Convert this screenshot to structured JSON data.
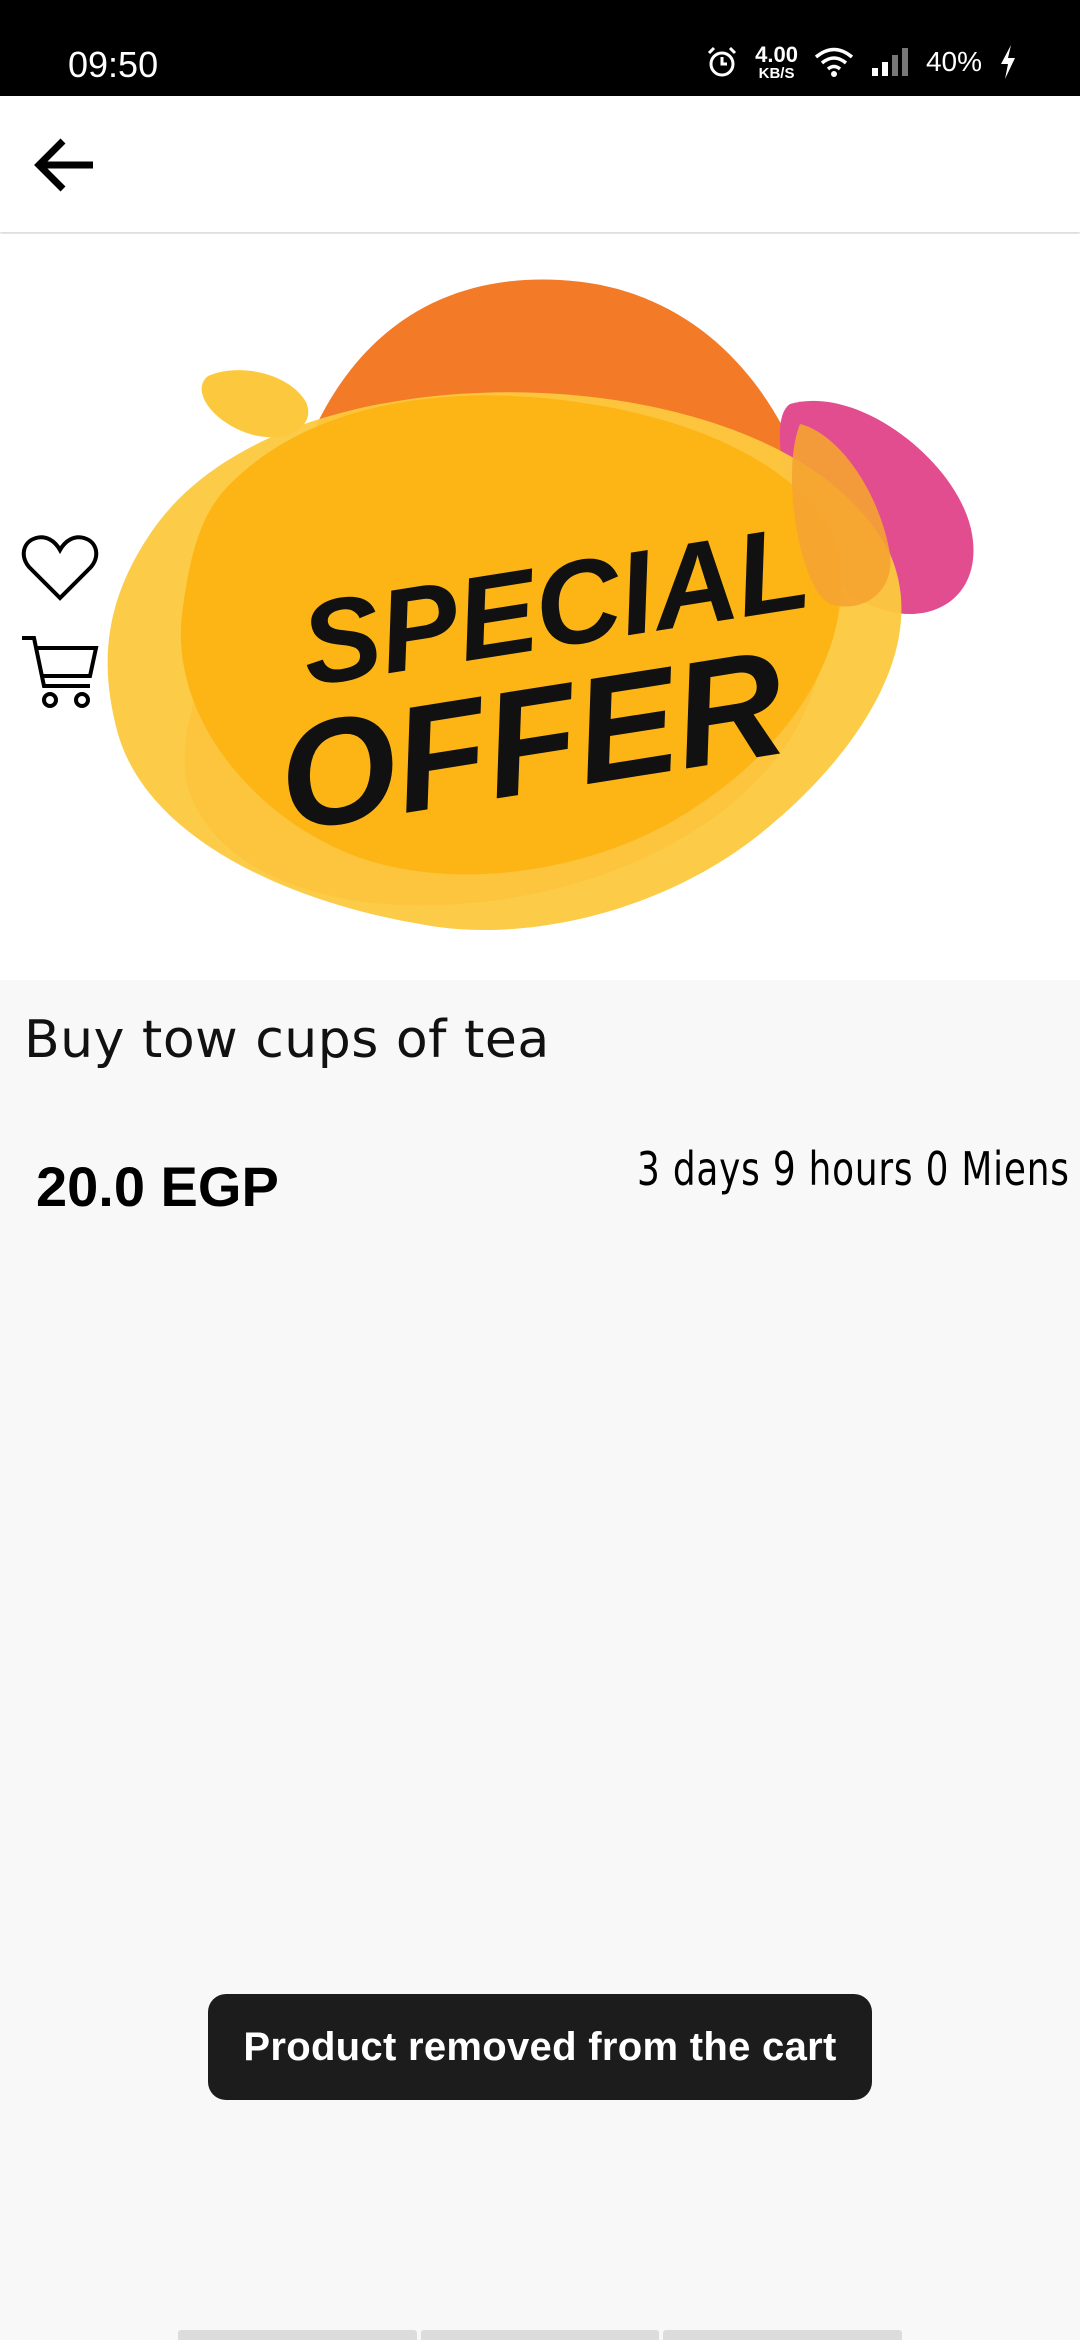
{
  "status_bar": {
    "time": "09:50",
    "net_speed_value": "4.00",
    "net_speed_unit": "KB/S",
    "battery": "40%"
  },
  "app_bar": {
    "back_icon": "arrow-left-icon"
  },
  "product": {
    "banner_line1": "SPECIAL",
    "banner_line2": "OFFER",
    "title": "Buy tow cups of tea",
    "price": "20.0 EGP",
    "countdown": "3 days 9 hours 0 Miens"
  },
  "actions": {
    "favorite_icon": "heart-icon",
    "cart_icon": "cart-icon"
  },
  "toast": {
    "message": "Product removed from the cart"
  },
  "colors": {
    "orange": "#f37a26",
    "yellow": "#fdb515",
    "light_yellow": "#fcc93e",
    "pink": "#e24d8f"
  }
}
